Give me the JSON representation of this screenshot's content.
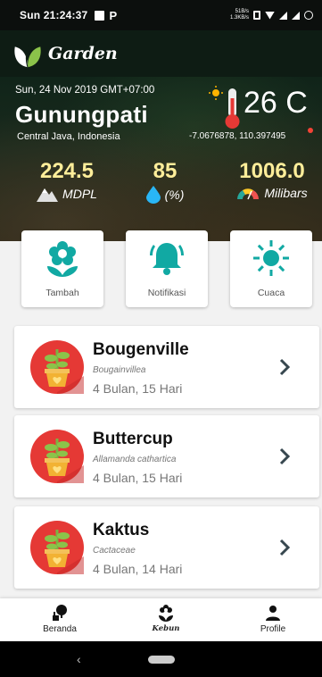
{
  "status_bar": {
    "time": "Sun 21:24:37",
    "net_up": "51B/s",
    "net_down": "1.3KB/s"
  },
  "app": {
    "title": "Garden"
  },
  "weather": {
    "date": "Sun, 24 Nov 2019 GMT+07:00",
    "city": "Gunungpati",
    "region": "Central Java, Indonesia",
    "temperature": "26 C",
    "coordinates": "-7.0676878, 110.397495",
    "metrics": [
      {
        "value": "224.5",
        "unit": "MDPL",
        "icon": "mountain-icon"
      },
      {
        "value": "85",
        "unit": "(%)",
        "icon": "water-drop-icon"
      },
      {
        "value": "1006.0",
        "unit": "Milibars",
        "icon": "gauge-icon"
      }
    ]
  },
  "actions": [
    {
      "label": "Tambah",
      "icon": "flower-icon"
    },
    {
      "label": "Notifikasi",
      "icon": "bell-icon"
    },
    {
      "label": "Cuaca",
      "icon": "sun-icon"
    }
  ],
  "plants": [
    {
      "name": "Bougenville",
      "latin": "Bougainvillea",
      "age": "4 Bulan, 15 Hari"
    },
    {
      "name": "Buttercup",
      "latin": "Allamanda cathartica",
      "age": "4 Bulan, 15 Hari"
    },
    {
      "name": "Kaktus",
      "latin": "Cactaceae",
      "age": "4 Bulan, 14 Hari"
    }
  ],
  "bottom_nav": [
    {
      "label": "Beranda",
      "icon": "home-plant-icon"
    },
    {
      "label": "Kebun",
      "icon": "garden-icon"
    },
    {
      "label": "Profile",
      "icon": "person-icon"
    }
  ],
  "colors": {
    "accent": "#11a9a3",
    "metric_value": "#ffee9a",
    "avatar_red": "#e53935",
    "pot": "#f2b233"
  }
}
